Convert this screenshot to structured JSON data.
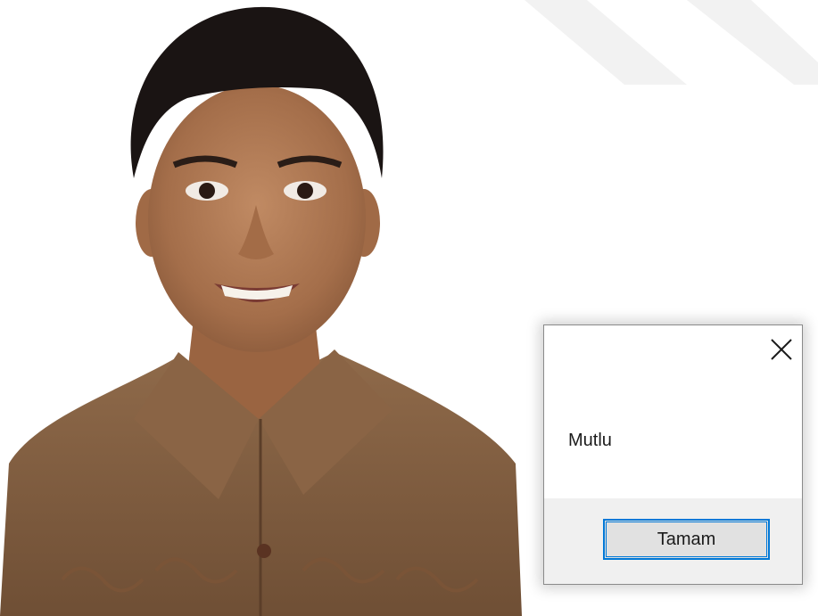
{
  "dialog": {
    "message": "Mutlu",
    "ok_label": "Tamam",
    "close_icon": "close-icon",
    "accent_color": "#0078d7"
  },
  "background": {
    "photo": "portrait-photo",
    "watermark": "diagonal-stripes"
  }
}
